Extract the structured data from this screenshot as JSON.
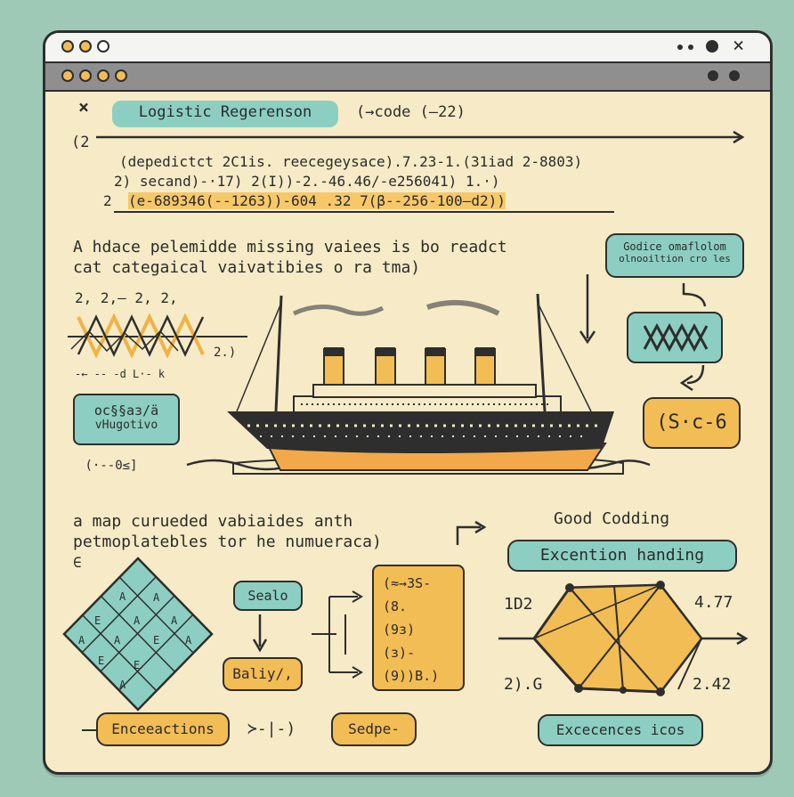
{
  "header": {
    "close": "×",
    "title": "Logistic Regerenson",
    "code_note": "(→code (—22)"
  },
  "code": {
    "line0": "(2",
    "line1": "(depedictct 2C1is. reecegeysace).7.23-1.(31iad 2-8803)",
    "line2": "2) secand)-·17) 2(I))-2.-46.46/-e256041) 1.·)",
    "line3_prefix": "2",
    "line3": "(e-689346(--1263))-604 .32 7(β--256-100—d2))"
  },
  "section1": {
    "line1": "A hdace pelemidde missing vaiees is bo readct",
    "line2": "cat categaical vaivatibies o ra tma)"
  },
  "wave_chart": {
    "top_labels": "2, 2,— 2, 2,",
    "right_label": "2.)",
    "bottom_labels": "-← -- -d   L·- k"
  },
  "left_box": {
    "line1": "oc§§aɜ/ä",
    "line2": "vHugotivo"
  },
  "left_tag": "(·--0≤]",
  "right_panel": {
    "top_line1": "Godice omaflolom",
    "top_line2": "olnooiltion cro les",
    "bottom": "(S·c-6"
  },
  "section2": {
    "line1": "a map curueded vabiaides anth",
    "line2": "petmoplatebles tor he numueraca)",
    "mark": "∈"
  },
  "grid_letters": [
    "A",
    "A",
    "E",
    "A",
    "A",
    "A",
    "A",
    "E",
    "A",
    "E",
    "E",
    "A"
  ],
  "flow": {
    "scale": "Sealo",
    "bali": "Baliy/,"
  },
  "code_box": [
    "(≈→3S-",
    "(8.",
    "(9ɜ)",
    "(ɜ)-",
    "(9))B.)"
  ],
  "right_section": {
    "title": "Good Codding",
    "button": "Excention handing",
    "label_tl": "1D2",
    "label_tr": "4.77",
    "label_bl": "2).G",
    "label_br": "2.42"
  },
  "bottom": {
    "left": "Enceeactions",
    "mid": "≻-|-)",
    "center": "Sedpe-",
    "right": "Excecences icos"
  },
  "colors": {
    "teal": "#8ccfc2",
    "orange": "#f3bd55",
    "paper": "#f6ebc6",
    "ink": "#2e2e2e"
  }
}
